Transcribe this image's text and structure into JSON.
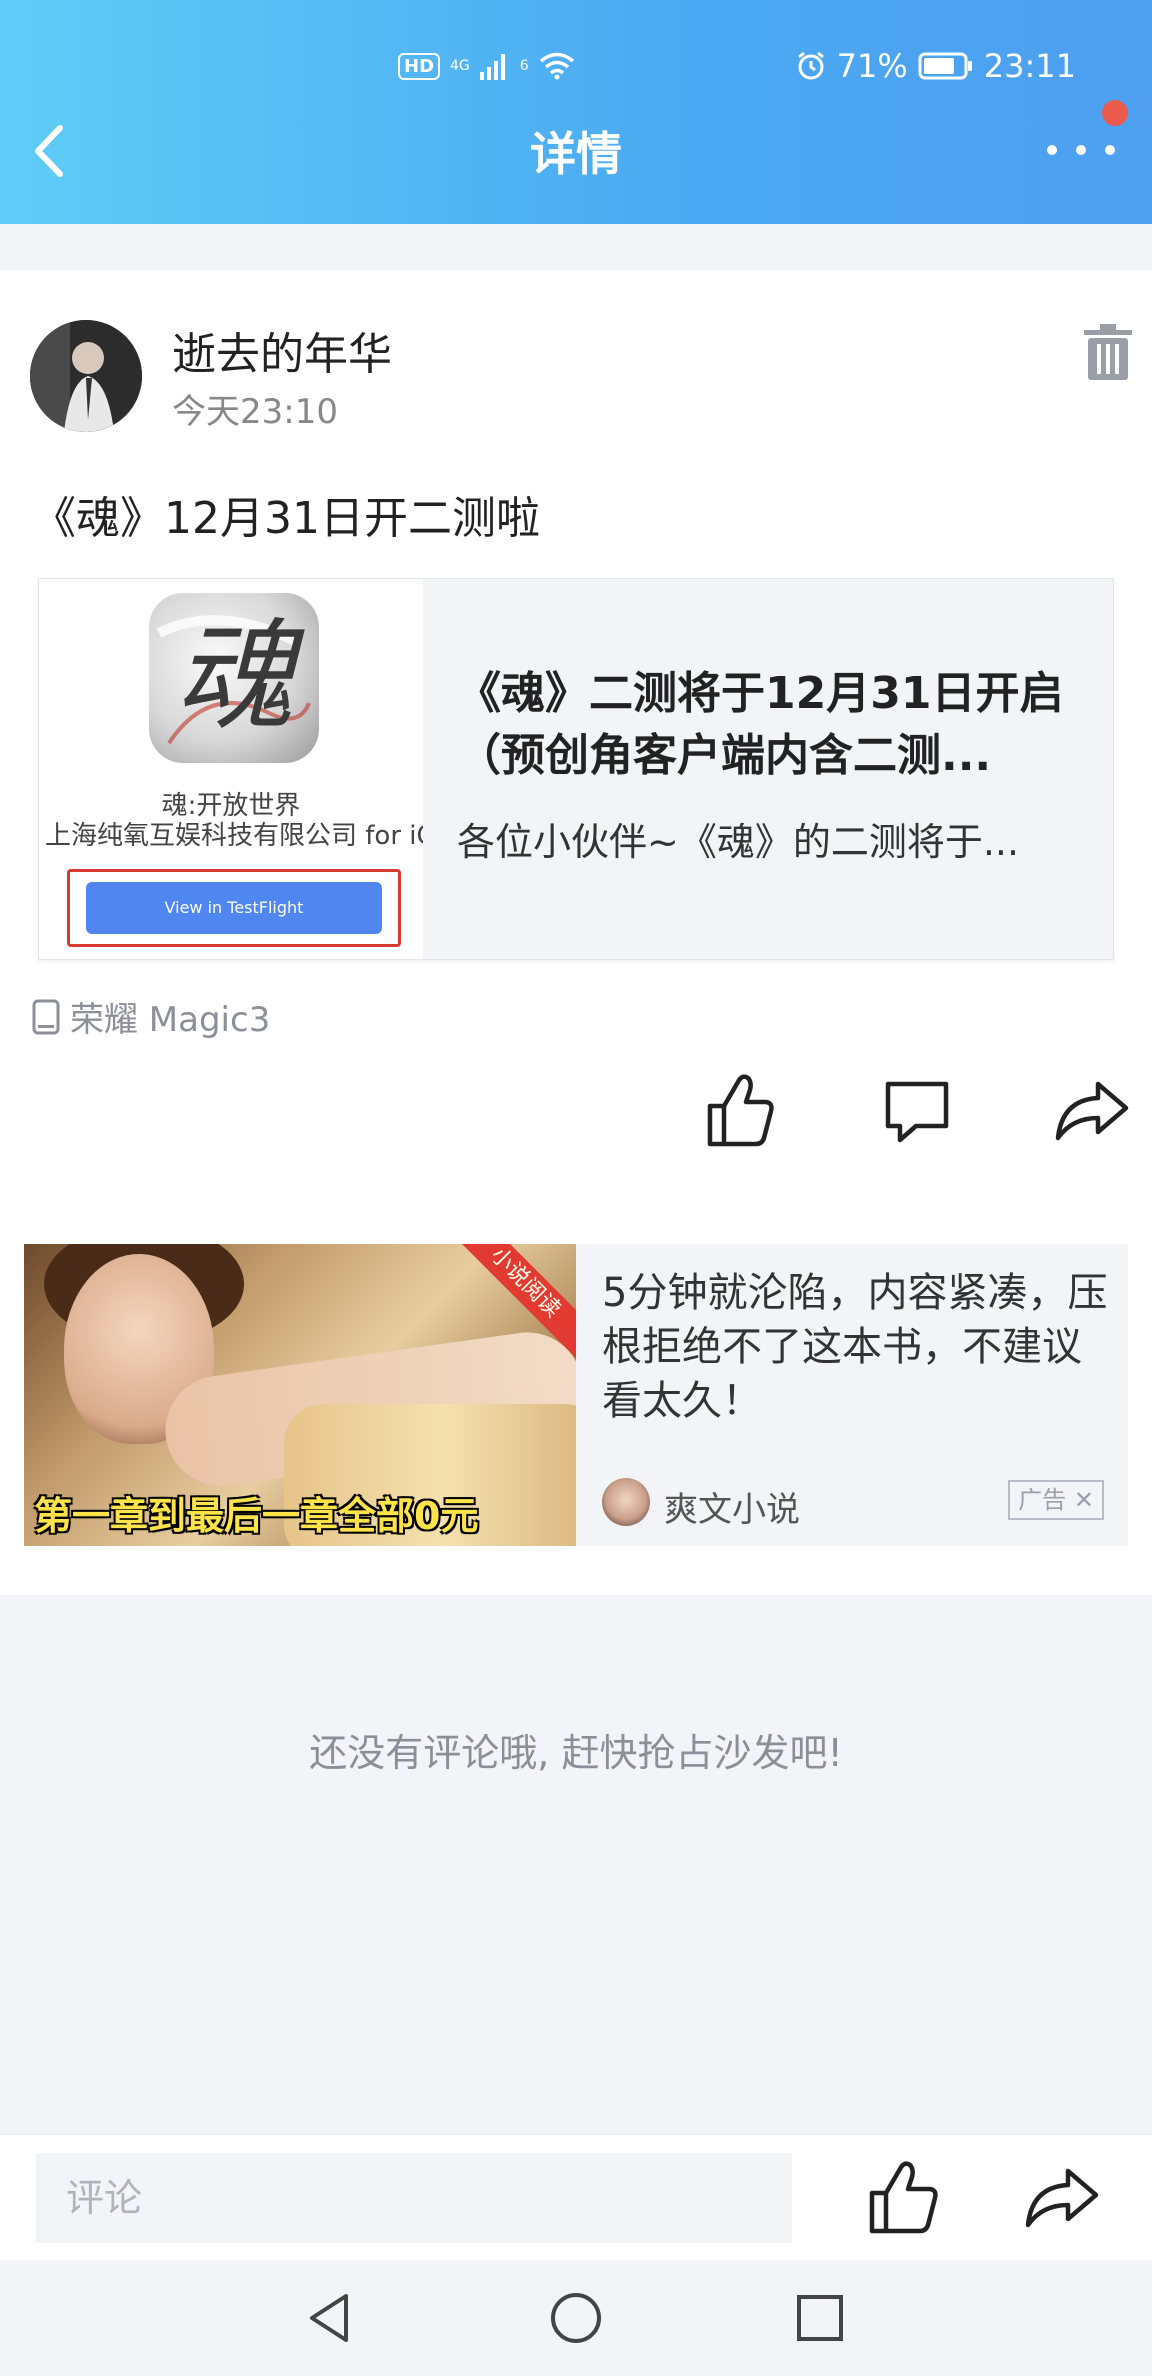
{
  "status_bar": {
    "hd": "HD",
    "signal_label": "4G",
    "wifi_label": "6",
    "battery": "71%",
    "time": "23:11"
  },
  "header": {
    "title": "详情"
  },
  "post": {
    "username": "逝去的年华",
    "time": "今天23:10",
    "text": "《魂》12月31日开二测啦",
    "link_card": {
      "app_icon_char": "魂",
      "app_name": "魂:开放世界",
      "app_company": "上海纯氧互娱科技有限公司 for iOS",
      "testflight_button": "View in TestFlight",
      "title": "《魂》二测将于12月31日开启（预创角客户端内含二测...",
      "description": "各位小伙伴~《魂》的二测将于..."
    },
    "device": "荣耀 Magic3"
  },
  "ad": {
    "ribbon": "小说阅读",
    "caption": "第一章到最后一章全部0元",
    "text": "5分钟就沦陷，内容紧凑，压根拒绝不了这本书，不建议看太久！",
    "source": "爽文小说",
    "tag": "广告"
  },
  "comments": {
    "empty_text": "还没有评论哦, 赶快抢占沙发吧!"
  },
  "bottom_bar": {
    "comment_placeholder": "评论"
  },
  "colors": {
    "header_gradient_start": "#5fcdf6",
    "header_gradient_end": "#4e9ff0",
    "notification_dot": "#ec5a4c",
    "testflight_blue": "#4f86ef",
    "highlight_red": "#d63b32"
  },
  "icons": {
    "back": "chevron-left-icon",
    "more": "more-dots-icon",
    "trash": "trash-icon",
    "device": "phone-icon",
    "like": "thumbs-up-icon",
    "comment": "comment-bubble-icon",
    "share": "share-arrow-icon",
    "nav_back": "triangle-back-icon",
    "nav_home": "circle-home-icon",
    "nav_recent": "square-recent-icon"
  }
}
